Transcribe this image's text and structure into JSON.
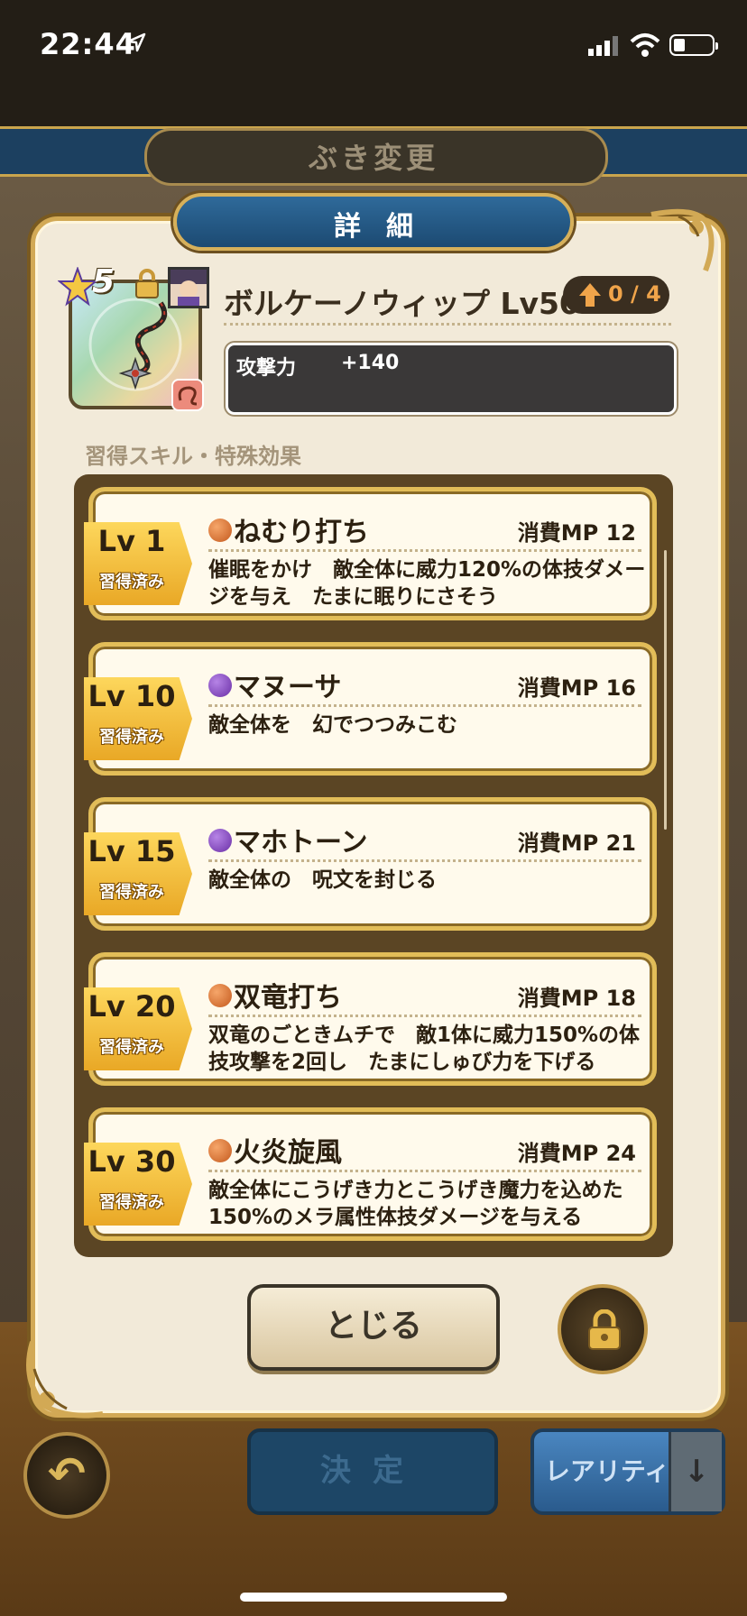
{
  "status_bar": {
    "time": "22:44"
  },
  "screen_title": "ぶき変更",
  "panel": {
    "title": "詳細",
    "weapon": {
      "rarity": "5",
      "name": "ボルケーノウィップ Lv50",
      "upgrade": "0 / 4",
      "stat_label": "攻撃力",
      "stat_value": "+140"
    },
    "section_label": "習得スキル・特殊効果",
    "skills": [
      {
        "level": "Lv 1",
        "learned": "習得済み",
        "icon": "orange-skill-icon",
        "name": "ねむり打ち",
        "mp": "消費MP 12",
        "desc": "催眠をかけ　敵全体に威力120%の体技ダメージを与え　たまに眠りにさそう"
      },
      {
        "level": "Lv 10",
        "learned": "習得済み",
        "icon": "purple-skill-icon",
        "name": "マヌーサ",
        "mp": "消費MP 16",
        "desc": "敵全体を　幻でつつみこむ"
      },
      {
        "level": "Lv 15",
        "learned": "習得済み",
        "icon": "purple-skill-icon",
        "name": "マホトーン",
        "mp": "消費MP 21",
        "desc": "敵全体の　呪文を封じる"
      },
      {
        "level": "Lv 20",
        "learned": "習得済み",
        "icon": "orange-skill-icon",
        "name": "双竜打ち",
        "mp": "消費MP 18",
        "desc": "双竜のごときムチで　敵1体に威力150%の体技攻撃を2回し　たまにしゅび力を下げる"
      },
      {
        "level": "Lv 30",
        "learned": "習得済み",
        "icon": "orange-skill-icon",
        "name": "火炎旋風",
        "mp": "消費MP 24",
        "desc": "敵全体にこうげき力とこうげき魔力を込めた150%のメラ属性体技ダメージを与える"
      }
    ],
    "close_label": "とじる"
  },
  "bottom": {
    "decide_label": "決定",
    "rarity_label": "レアリティ"
  },
  "colors": {
    "accent_gold": "#d2a955",
    "panel_bg": "#f2ead9",
    "blue": "#1c4a72"
  }
}
